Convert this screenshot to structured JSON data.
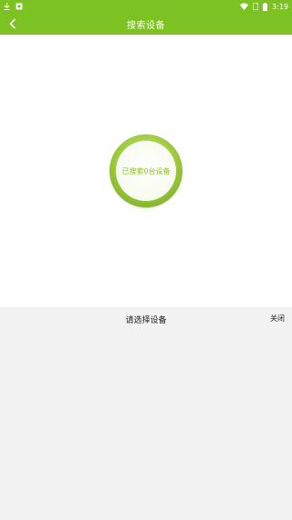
{
  "status_bar": {
    "time": "3:19",
    "left_icons": [
      "download-icon",
      "app-notification-icon"
    ],
    "right_icons": [
      "wifi-icon",
      "sim-icon",
      "battery-icon"
    ]
  },
  "header": {
    "title": "搜索设备",
    "back_icon": "chevron-left-icon",
    "color": "#7cc223"
  },
  "scan": {
    "status_text": "已搜索0台设备",
    "count": 0
  },
  "device_panel": {
    "title": "请选择设备",
    "close_label": "关闭",
    "devices": []
  }
}
